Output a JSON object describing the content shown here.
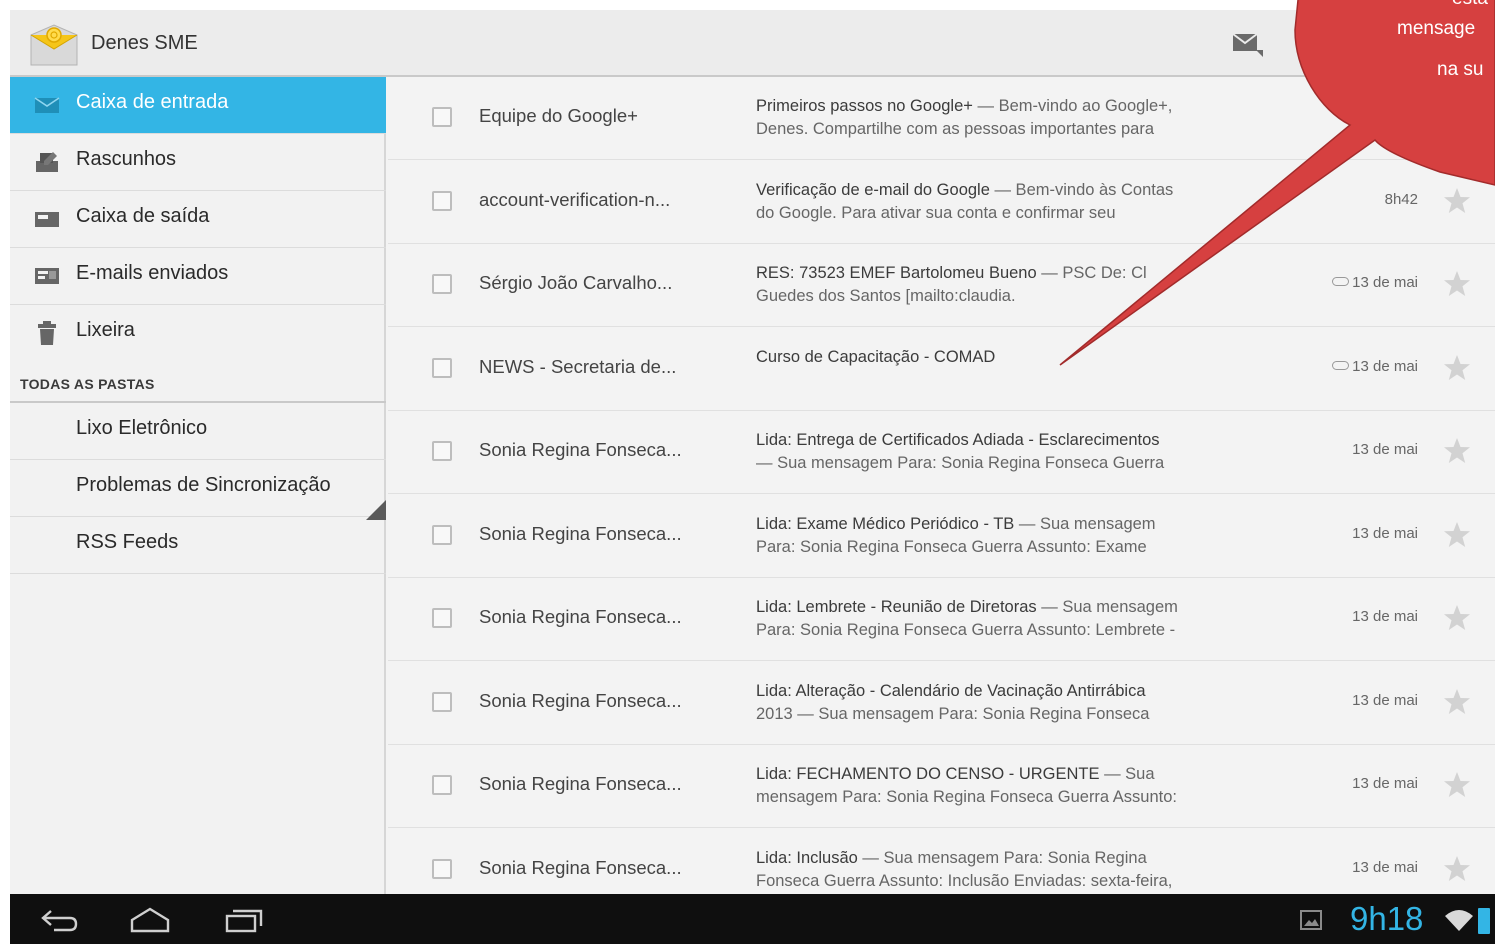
{
  "account": {
    "name": "Denes SME"
  },
  "sidebar": {
    "folders": [
      {
        "label": "Caixa de entrada",
        "icon": "inbox-icon",
        "active": true
      },
      {
        "label": "Rascunhos",
        "icon": "drafts-icon"
      },
      {
        "label": "Caixa de saída",
        "icon": "outbox-icon"
      },
      {
        "label": "E-mails enviados",
        "icon": "sent-icon"
      },
      {
        "label": "Lixeira",
        "icon": "trash-icon"
      }
    ],
    "section_header": "TODAS AS PASTAS",
    "all_folders": [
      {
        "label": "Lixo Eletrônico"
      },
      {
        "label": "Problemas de Sincronização"
      },
      {
        "label": "RSS Feeds"
      }
    ]
  },
  "messages": [
    {
      "sender": "Equipe do Google+",
      "subject": "Primeiros passos no Google+",
      "snippet_1": " — Bem-vindo ao Google+,",
      "line2": "Denes. Compartilhe com as pessoas importantes para",
      "date": "",
      "tag": false
    },
    {
      "sender": "account-verification-n...",
      "subject": "Verificação de e-mail do Google",
      "snippet_1": " — Bem-vindo às Contas",
      "line2": "do Google. Para ativar sua conta e confirmar seu",
      "date": "8h42",
      "tag": false
    },
    {
      "sender": "Sérgio João Carvalho...",
      "subject": "RES: 73523 EMEF Bartolomeu Bueno",
      "snippet_1": " — PSC De: Cl",
      "line2": "Guedes dos Santos [mailto:claudia.",
      "date": "13 de mai",
      "tag": true
    },
    {
      "sender": "NEWS - Secretaria de...",
      "subject": "Curso de Capacitação - COMAD",
      "snippet_1": "",
      "line2": "",
      "date": "13 de mai",
      "tag": true
    },
    {
      "sender": "Sonia Regina Fonseca...",
      "subject": "Lida: Entrega de Certificados Adiada - Esclarecimentos",
      "snippet_1": "",
      "line2": "— Sua mensagem Para: Sonia Regina Fonseca Guerra",
      "date": "13 de mai",
      "tag": false
    },
    {
      "sender": "Sonia Regina Fonseca...",
      "subject": "Lida: Exame Médico Periódico - TB",
      "snippet_1": " — Sua mensagem",
      "line2": "Para: Sonia Regina Fonseca Guerra Assunto: Exame",
      "date": "13 de mai",
      "tag": false
    },
    {
      "sender": "Sonia Regina Fonseca...",
      "subject": "Lida: Lembrete - Reunião de Diretoras",
      "snippet_1": " — Sua mensagem",
      "line2": "Para: Sonia Regina Fonseca Guerra Assunto: Lembrete -",
      "date": "13 de mai",
      "tag": false
    },
    {
      "sender": "Sonia Regina Fonseca...",
      "subject": "Lida: Alteração - Calendário de Vacinação Antirrábica",
      "snippet_1": "",
      "line2": "2013 — Sua mensagem Para: Sonia Regina Fonseca",
      "date": "13 de mai",
      "tag": false
    },
    {
      "sender": "Sonia Regina Fonseca...",
      "subject": "Lida: FECHAMENTO DO CENSO - URGENTE",
      "snippet_1": " — Sua",
      "line2": "mensagem Para: Sonia Regina Fonseca Guerra Assunto:",
      "date": "13 de mai",
      "tag": false
    },
    {
      "sender": "Sonia Regina Fonseca...",
      "subject": "Lida: Inclusão",
      "snippet_1": " — Sua mensagem Para: Sonia Regina",
      "line2": "Fonseca Guerra Assunto: Inclusão Enviadas: sexta-feira,",
      "date": "13 de mai",
      "tag": false
    }
  ],
  "callout": {
    "line1": "esta",
    "line2": "mensage",
    "line3": "na su",
    "color": "#d64040"
  },
  "status_bar": {
    "time": "9h18"
  },
  "colors": {
    "accent": "#33b5e5",
    "background": "#f3f3f3"
  }
}
